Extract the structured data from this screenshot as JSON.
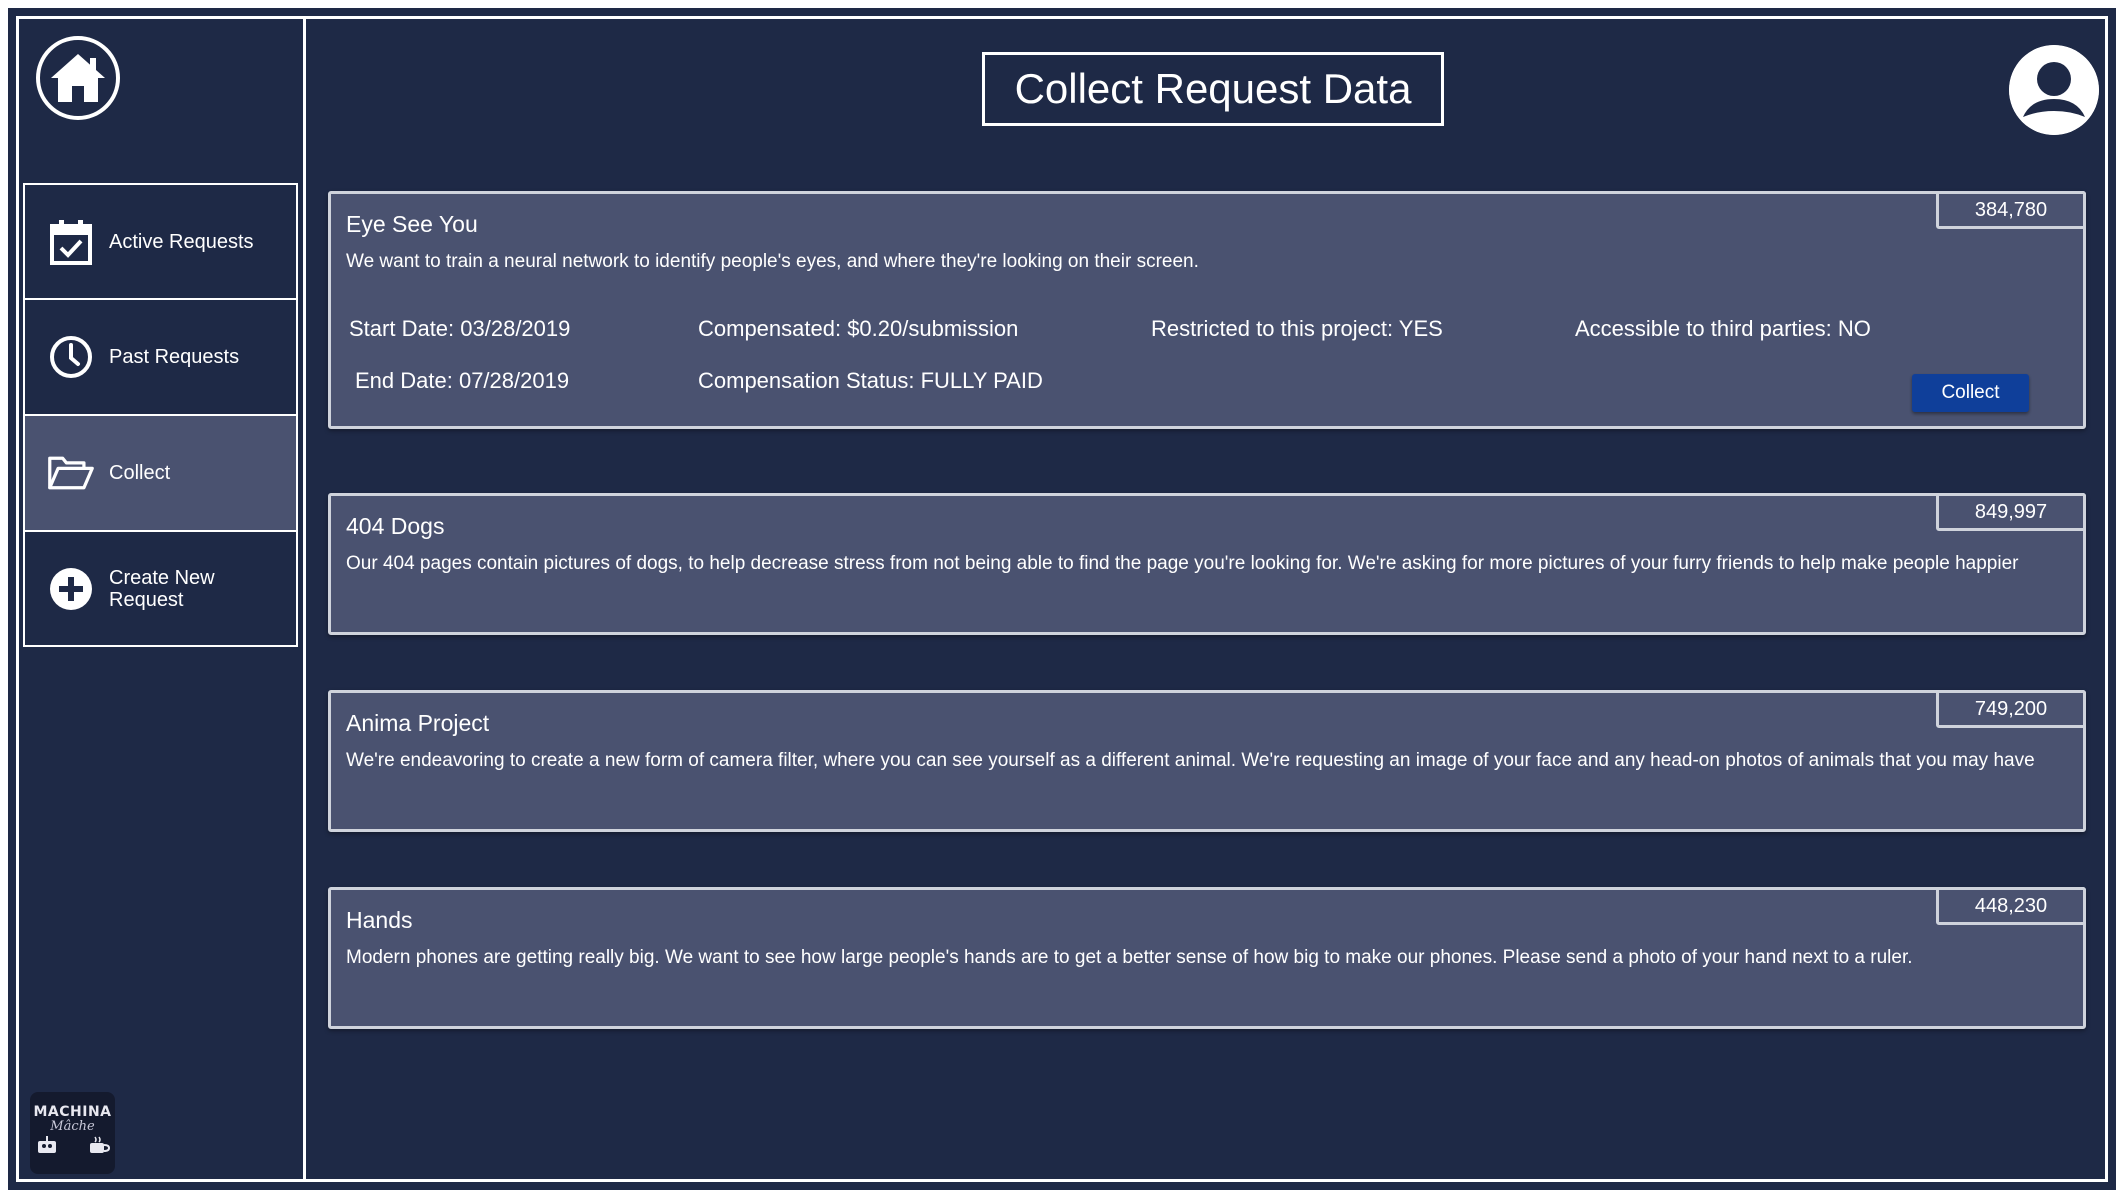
{
  "page": {
    "title": "Collect Request Data"
  },
  "sidebar": {
    "items": [
      {
        "label": "Active Requests",
        "icon": "calendar-check-icon"
      },
      {
        "label": "Past Requests",
        "icon": "clock-icon"
      },
      {
        "label": "Collect",
        "icon": "folder-open-icon",
        "active": true
      },
      {
        "label": "Create New Request",
        "icon": "plus-circle-icon"
      }
    ]
  },
  "logo": {
    "line1": "MACHINA",
    "line2": "Mâche"
  },
  "requests": [
    {
      "title": "Eye See You",
      "count": "384,780",
      "description": "We want to train a neural network to identify people's eyes, and where they're looking on their screen.",
      "start_date": "Start Date: 03/28/2019",
      "end_date": "End Date: 07/28/2019",
      "compensated": "Compensated: $0.20/submission",
      "compensation_status": "Compensation Status: FULLY PAID",
      "restricted": "Restricted to this project: YES",
      "third_parties": "Accessible to third parties: NO",
      "button_label": "Collect"
    },
    {
      "title": "404 Dogs",
      "count": "849,997",
      "description": "Our 404 pages contain pictures of dogs, to help decrease stress from not being able to find the page you're looking for. We're asking for more pictures of your furry friends to help make people happier"
    },
    {
      "title": "Anima Project",
      "count": "749,200",
      "description": "We're endeavoring to create a new form of camera filter, where you can see yourself as a different animal. We're requesting an image of your face and any head-on photos of animals that you may have"
    },
    {
      "title": "Hands",
      "count": "448,230",
      "description": "Modern phones are getting really big. We want to see how large people's hands are to get a better sense of how big to make our phones. Please send a photo of your hand next to a ruler."
    }
  ],
  "colors": {
    "background": "#1e2946",
    "card": "#4a5270",
    "active_nav": "#4a5270",
    "button": "#0f3f9a"
  }
}
